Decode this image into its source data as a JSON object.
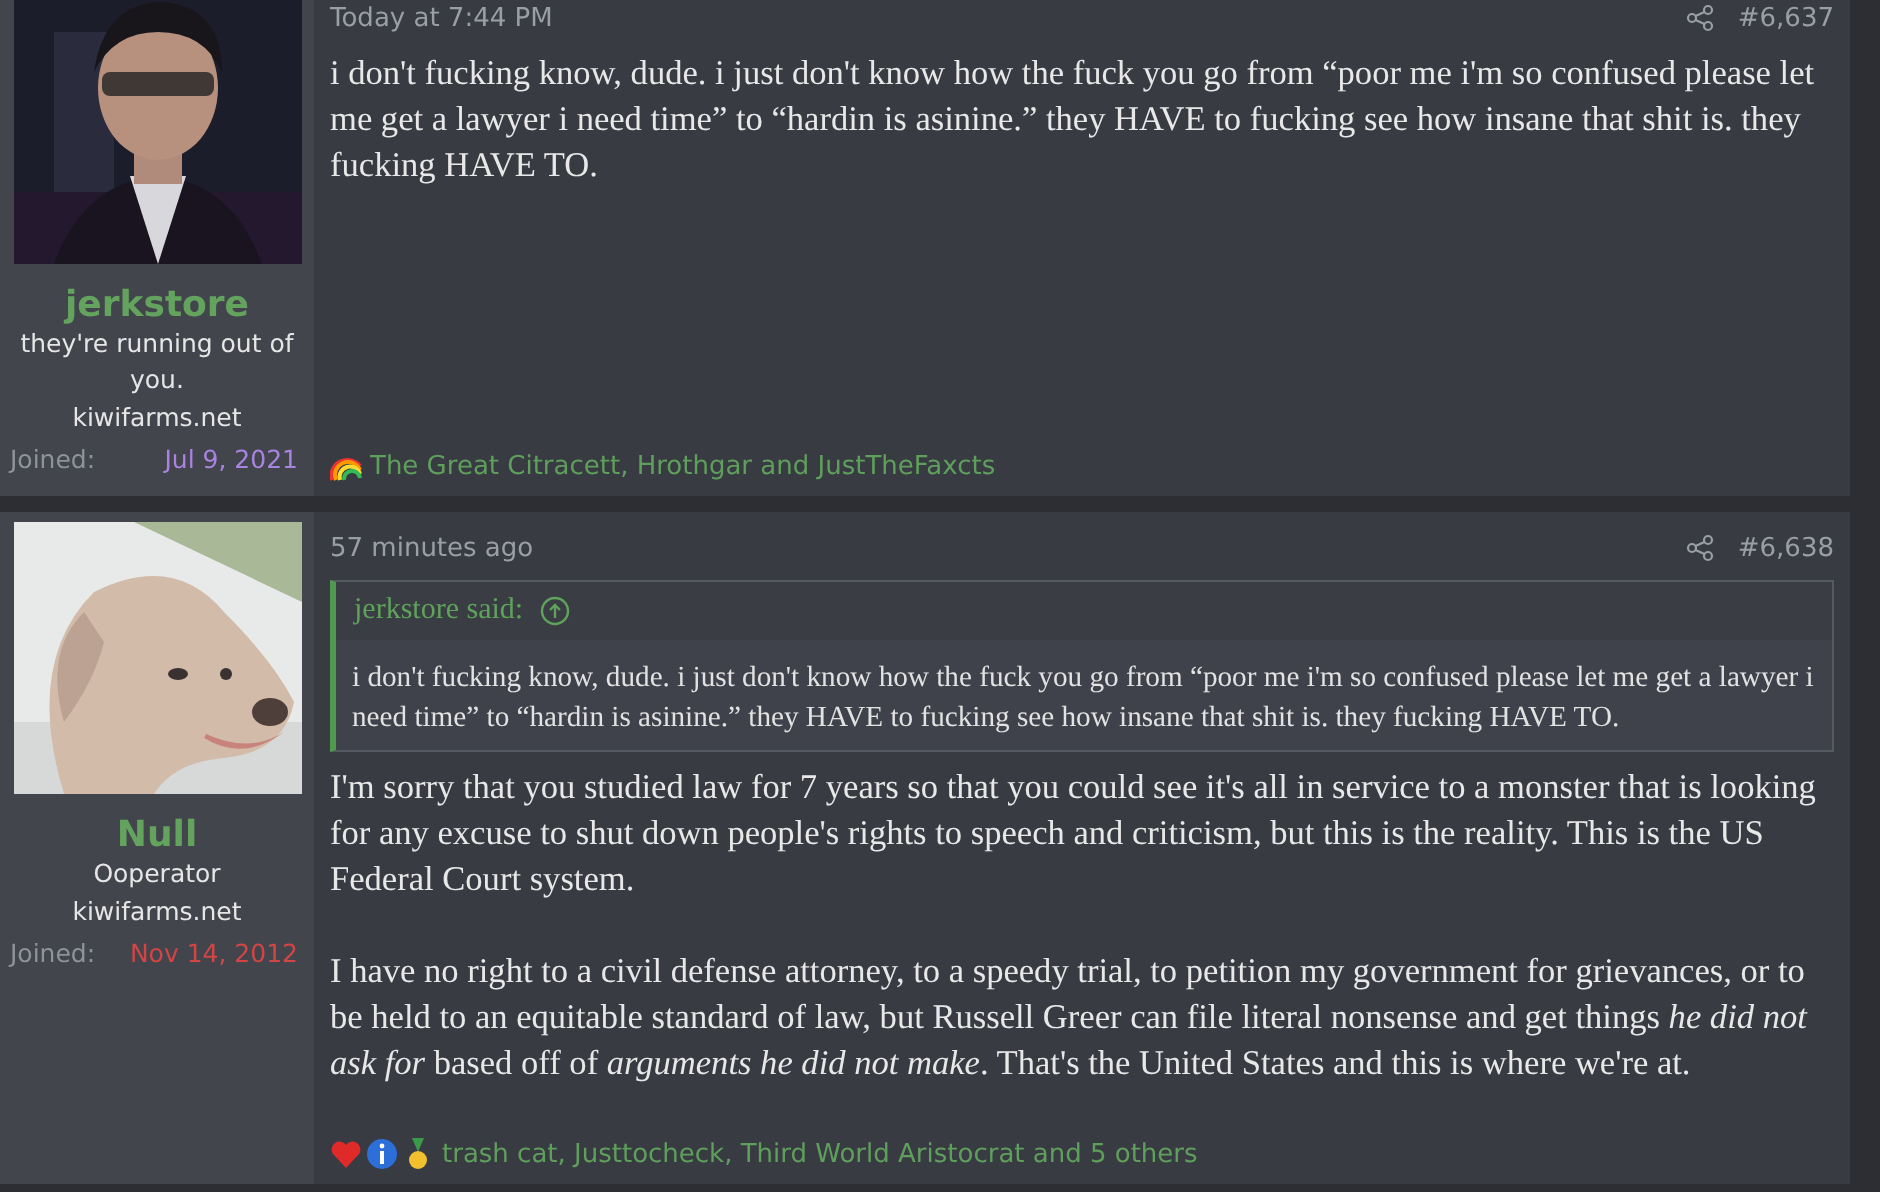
{
  "posts": [
    {
      "author": {
        "name": "jerkstore",
        "title": "they're running out of you.",
        "site": "kiwifarms.net",
        "joined_label": "Joined:",
        "joined": "Jul 9, 2021",
        "color": "#a983e0"
      },
      "time": "Today at 7:44 PM",
      "number": "#6,637",
      "paragraphs": [
        "i don't fucking know, dude. i just don't know how the fuck you go from “poor me i'm so confused please let me get a lawyer i need time” to “hardin is asinine.” they HAVE to fucking see how insane that shit is. they fucking HAVE TO."
      ],
      "reactions": {
        "icons": [
          {
            "kind": "rainbow"
          }
        ],
        "text": "The Great Citracett, Hrothgar and JustTheFaxcts"
      }
    },
    {
      "author": {
        "name": "Null",
        "title": "Ooperator",
        "site": "kiwifarms.net",
        "joined_label": "Joined:",
        "joined": "Nov 14, 2012",
        "color": "#d24545"
      },
      "time": "57 minutes ago",
      "number": "#6,638",
      "quote": {
        "author": "jerkstore said:",
        "text": "i don't fucking know, dude. i just don't know how the fuck you go from “poor me i'm so confused please let me get a lawyer i need time” to “hardin is asinine.” they HAVE to fucking see how insane that shit is. they fucking HAVE TO."
      },
      "paragraphs": [
        "I'm sorry that you studied law for 7 years so that you could see it's all in service to a monster that is looking for any excuse to shut down people's rights to speech and criticism, but this is the reality. This is the US Federal Court system.",
        "I have no right to a civil defense attorney, to a speedy trial, to petition my government for grievances, or to be held to an equitable standard of law, but Russell Greer can file literal nonsense and get things *he did not ask for* based off of *arguments he did not make*. That's the United States and this is where we're at."
      ],
      "reactions": {
        "icons": [
          {
            "kind": "heart"
          },
          {
            "kind": "info"
          },
          {
            "kind": "medal"
          }
        ],
        "text": "trash cat, Justtocheck, Third World Aristocrat and 5 others"
      }
    }
  ]
}
